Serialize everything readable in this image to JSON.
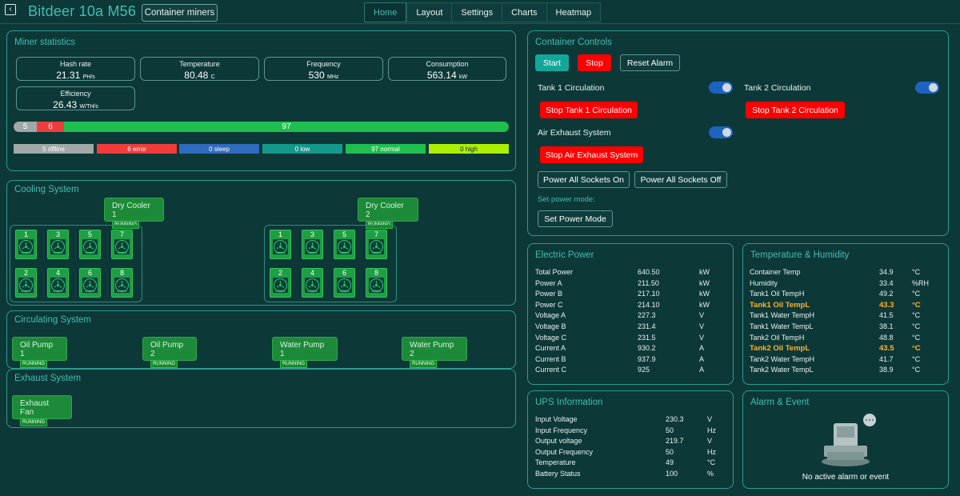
{
  "header": {
    "title": "Bitdeer 10a M56",
    "container_button": "Container miners",
    "tabs": [
      "Home",
      "Layout",
      "Settings",
      "Charts",
      "Heatmap"
    ]
  },
  "miner_stats": {
    "title": "Miner statistics",
    "hash_rate": {
      "label": "Hash rate",
      "value": "21.31",
      "unit": "PH/s"
    },
    "temperature": {
      "label": "Temperature",
      "value": "80.48",
      "unit": "C"
    },
    "frequency": {
      "label": "Frequency",
      "value": "530",
      "unit": "MHz"
    },
    "consumption": {
      "label": "Consumption",
      "value": "563.14",
      "unit": "kW"
    },
    "efficiency": {
      "label": "Efficiency",
      "value": "26.43",
      "unit": "W/TH/s"
    },
    "bar": {
      "offline": "5",
      "error": "6",
      "normal": "97"
    },
    "legend": [
      "5 offline",
      "6 error",
      "0 sleep",
      "0 low",
      "97 normal",
      "0 high"
    ]
  },
  "cooling": {
    "title": "Cooling System",
    "dry_cooler_1": "Dry Cooler 1",
    "dry_cooler_2": "Dry Cooler 2",
    "status": "RUNNING",
    "fans": [
      "1",
      "3",
      "5",
      "7",
      "2",
      "4",
      "6",
      "8"
    ]
  },
  "circulating": {
    "title": "Circulating System",
    "pumps": [
      "Oil Pump 1",
      "Oil Pump 2",
      "Water Pump 1",
      "Water Pump 2"
    ],
    "status": "RUNNING"
  },
  "exhaust": {
    "title": "Exhaust System",
    "fan": "Exhaust Fan",
    "status": "RUNNING"
  },
  "controls": {
    "title": "Container Controls",
    "start": "Start",
    "stop": "Stop",
    "reset": "Reset Alarm",
    "tank1": "Tank 1 Circulation",
    "tank2": "Tank 2 Circulation",
    "stop_tank1": "Stop Tank 1 Circulation",
    "stop_tank2": "Stop Tank 2 Circulation",
    "air": "Air Exhaust System",
    "stop_air": "Stop Air Exhaust System",
    "power_on": "Power All Sockets On",
    "power_off": "Power All Sockets Off",
    "set_power_label": "Set power mode:",
    "set_power_btn": "Set Power Mode"
  },
  "electric": {
    "title": "Electric Power",
    "rows": [
      [
        "Total Power",
        "640.50",
        "kW"
      ],
      [
        "Power A",
        "211.50",
        "kW"
      ],
      [
        "Power B",
        "217.10",
        "kW"
      ],
      [
        "Power C",
        "214.10",
        "kW"
      ],
      [
        "Voltage A",
        "227.3",
        "V"
      ],
      [
        "Voltage B",
        "231.4",
        "V"
      ],
      [
        "Voltage C",
        "231.5",
        "V"
      ],
      [
        "Current A",
        "930.2",
        "A"
      ],
      [
        "Current B",
        "937.9",
        "A"
      ],
      [
        "Current C",
        "925",
        "A"
      ]
    ]
  },
  "temp_humidity": {
    "title": "Temperature & Humidity",
    "rows": [
      [
        "Container Temp",
        "34.9",
        "°C"
      ],
      [
        "Humidity",
        "33.4",
        "%RH"
      ],
      [
        "Tank1 Oil TempH",
        "49.2",
        "°C"
      ],
      [
        "Tank1 Oil TempL",
        "43.3",
        "°C"
      ],
      [
        "Tank1 Water TempH",
        "41.5",
        "°C"
      ],
      [
        "Tank1 Water TempL",
        "38.1",
        "°C"
      ],
      [
        "Tank2 Oil TempH",
        "48.8",
        "°C"
      ],
      [
        "Tank2 Oil TempL",
        "43.5",
        "°C"
      ],
      [
        "Tank2 Water TempH",
        "41.7",
        "°C"
      ],
      [
        "Tank2 Water TempL",
        "38.9",
        "°C"
      ]
    ]
  },
  "ups": {
    "title": "UPS Information",
    "rows": [
      [
        "Input Voltage",
        "230.3",
        "V"
      ],
      [
        "Input Frequency",
        "50",
        "Hz"
      ],
      [
        "Output voltage",
        "219.7",
        "V"
      ],
      [
        "Output Frequency",
        "50",
        "Hz"
      ],
      [
        "Temperature",
        "49",
        "°C"
      ],
      [
        "Battery Status",
        "100",
        "%"
      ]
    ]
  },
  "alarm": {
    "title": "Alarm & Event",
    "message": "No active alarm or event"
  },
  "colors": {
    "accent": "#3fbfb3",
    "error": "#f23c3c",
    "normal": "#1fbf4f",
    "sleep": "#2f6bbf",
    "low": "#13998c",
    "high": "#aaf000",
    "offline": "#a0a8a8",
    "warn": "#ffb42a"
  }
}
